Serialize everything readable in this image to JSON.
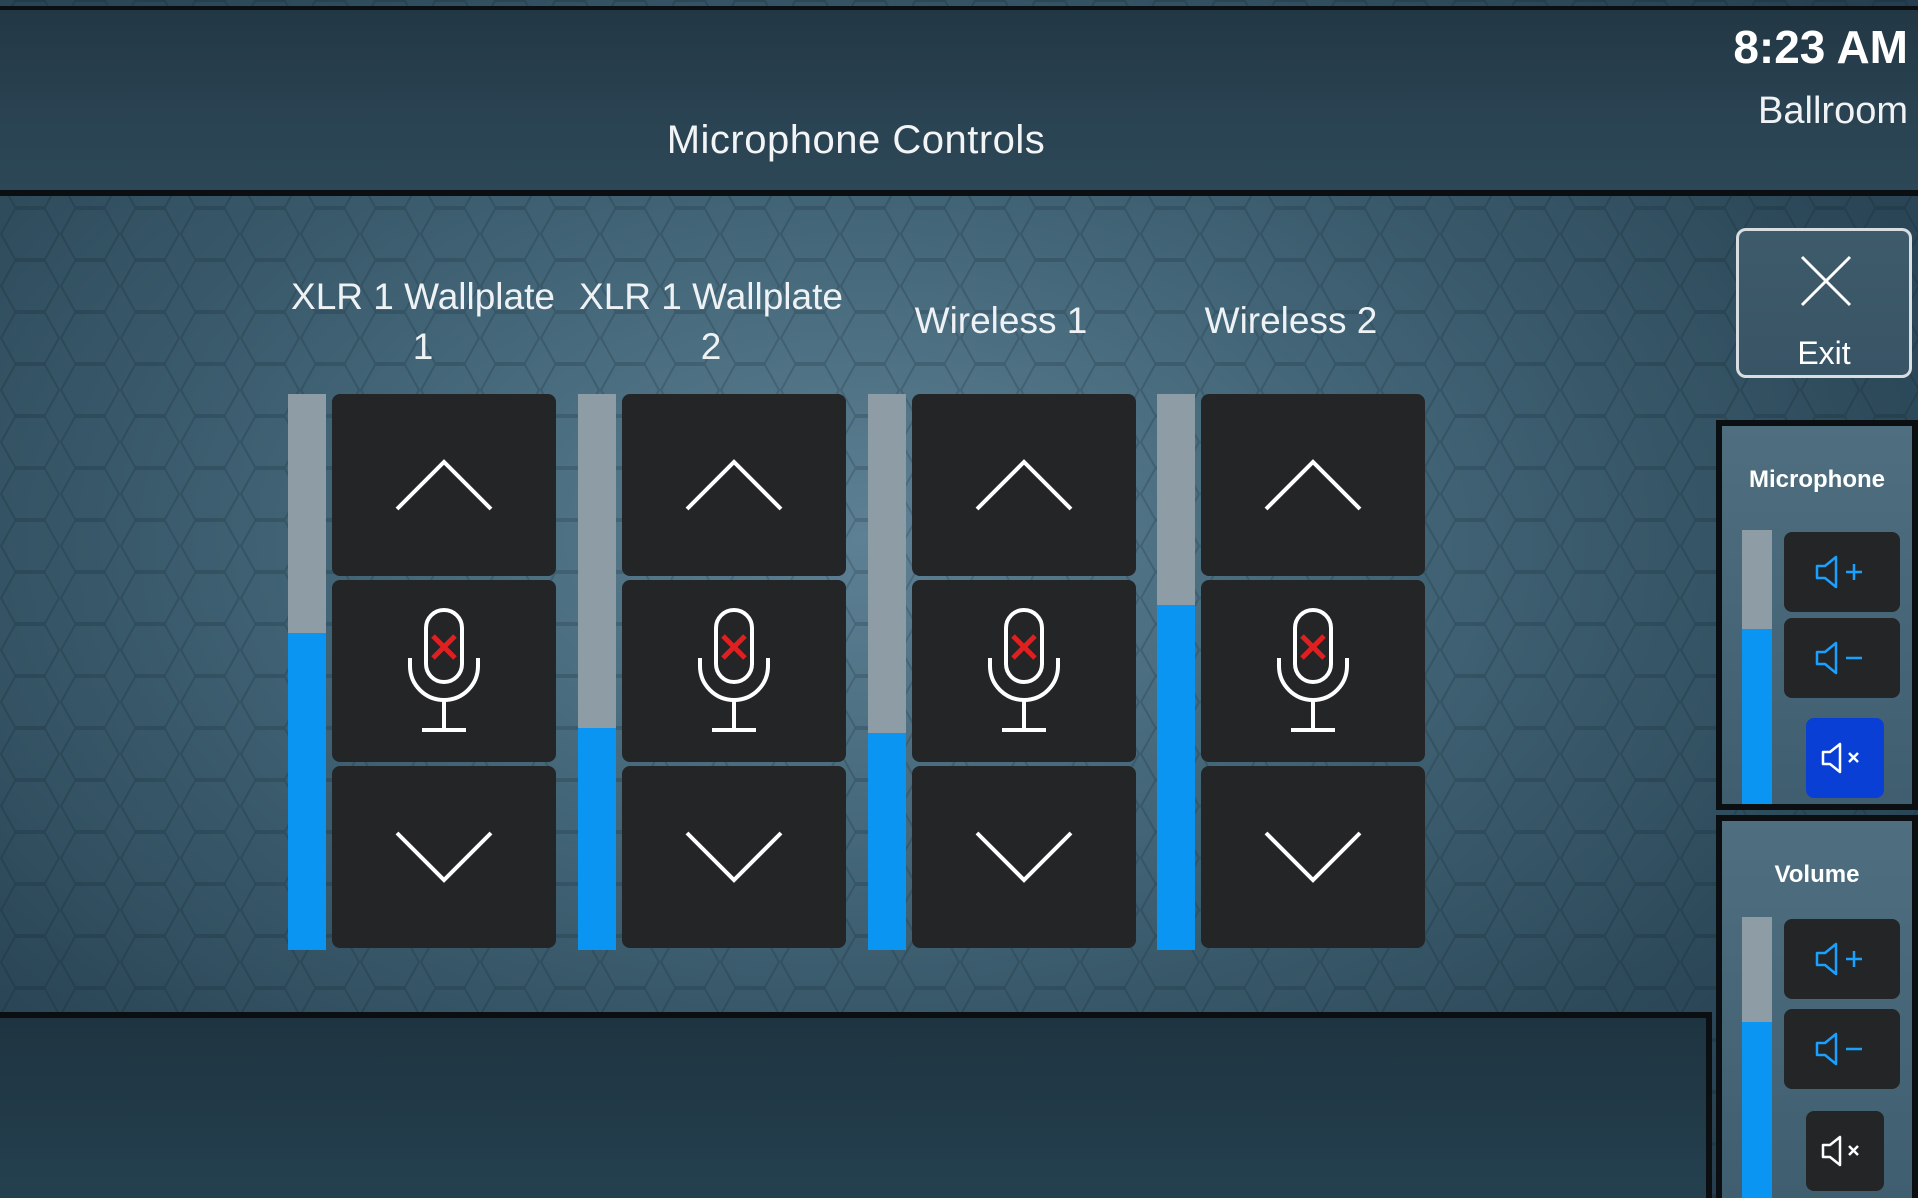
{
  "header": {
    "title": "Microphone Controls",
    "time": "8:23 AM",
    "room": "Ballroom"
  },
  "channels": [
    {
      "label": "XLR 1 Wallplate 1",
      "level": 0.57,
      "muted": true
    },
    {
      "label": "XLR 1 Wallplate 2",
      "level": 0.4,
      "muted": true
    },
    {
      "label": "Wireless 1",
      "level": 0.39,
      "muted": true
    },
    {
      "label": "Wireless 2",
      "level": 0.62,
      "muted": true
    }
  ],
  "exit": {
    "label": "Exit"
  },
  "microphone_panel": {
    "title": "Microphone",
    "level": 0.64,
    "muted": true
  },
  "volume_panel": {
    "title": "Volume",
    "level": 0.65,
    "muted": false
  },
  "colors": {
    "meter_fill": "#0a95f2",
    "mute_active": "#0a3fd6",
    "mic_mute_x": "#e02020"
  },
  "icons": {
    "up": "chevron-up-icon",
    "down": "chevron-down-icon",
    "mic_mute": "microphone-muted-icon",
    "vol_up": "speaker-plus-icon",
    "vol_down": "speaker-minus-icon",
    "vol_mute": "speaker-mute-icon",
    "exit": "close-icon"
  }
}
